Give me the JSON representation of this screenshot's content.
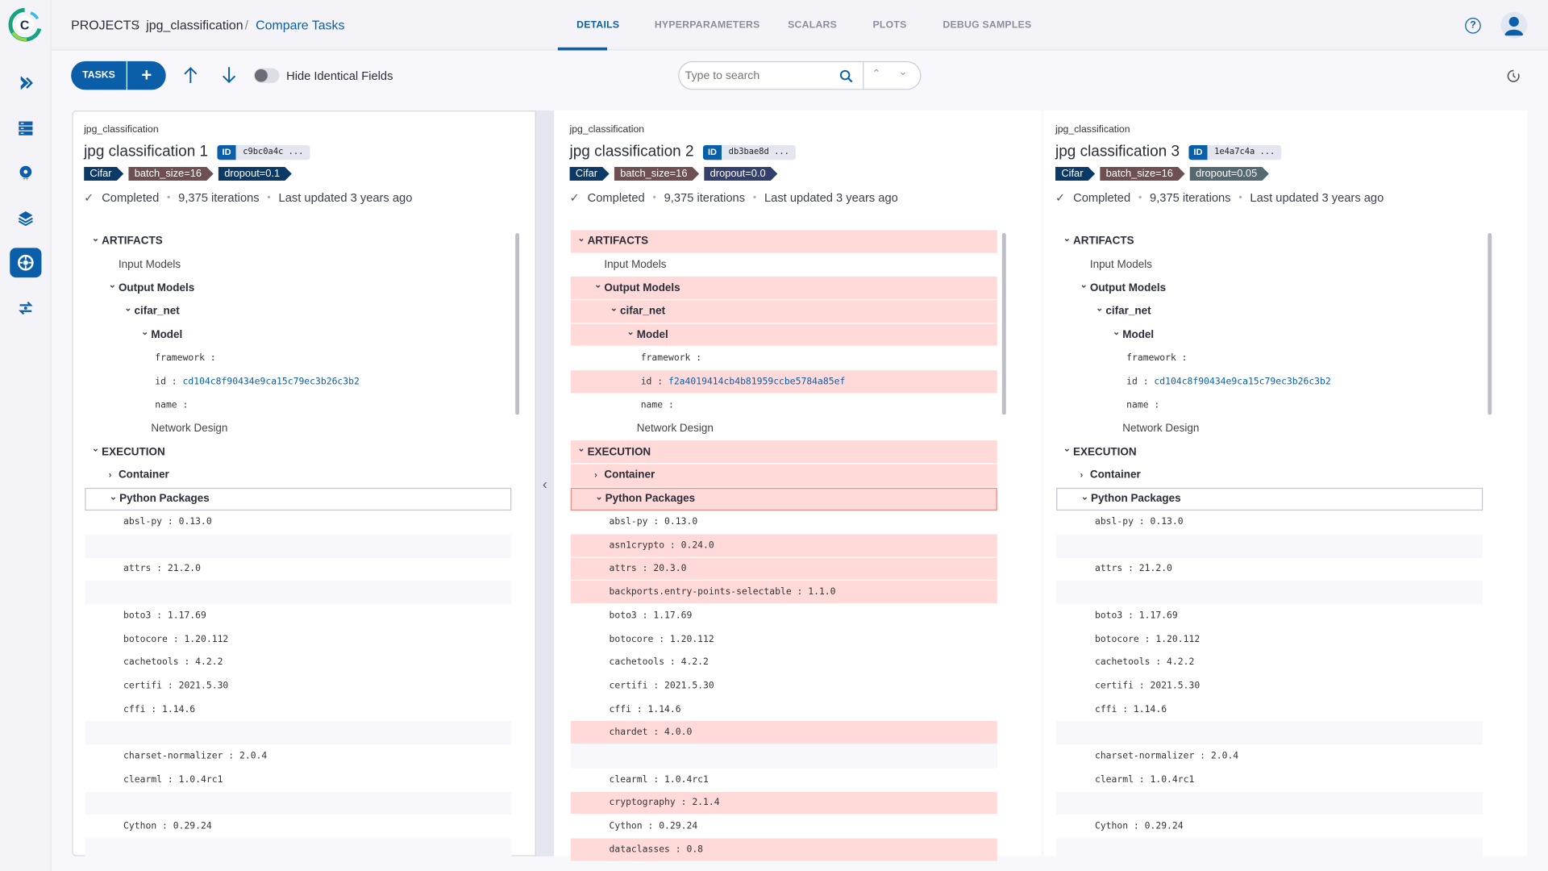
{
  "sidebar": {
    "items": [
      {
        "icon": "pipeline-arrow-icon",
        "active": false
      },
      {
        "icon": "datasets-grid-icon",
        "active": false
      },
      {
        "icon": "cloud-gear-icon",
        "active": false
      },
      {
        "icon": "layers-icon",
        "active": false
      },
      {
        "icon": "brain-models-icon",
        "active": true
      },
      {
        "icon": "orchestration-icon",
        "active": false
      }
    ]
  },
  "breadcrumb": {
    "root": "PROJECTS",
    "project": "jpg_classification",
    "current": "Compare Tasks",
    "sep": "/"
  },
  "tabs": [
    {
      "label": "DETAILS",
      "active": true
    },
    {
      "label": "HYPERPARAMETERS"
    },
    {
      "label": "SCALARS"
    },
    {
      "label": "PLOTS"
    },
    {
      "label": "DEBUG SAMPLES"
    }
  ],
  "toolbar": {
    "tasks_label": "TASKS",
    "add_label": "+",
    "hide_identical_label": "Hide Identical Fields",
    "hide_identical_on": false,
    "search_placeholder": "Type to search"
  },
  "colors": {
    "accent": "#0b5ea8",
    "diff": "#ffdad8",
    "tag_cifar": "#0b3a66",
    "tag_batch": "#6e5052"
  },
  "panels": [
    {
      "project": "jpg_classification",
      "title": "jpg classification 1",
      "id_label": "ID",
      "id": "c9bc0a4c ...",
      "tags": [
        {
          "text": "Cifar",
          "color": "#0b3a66"
        },
        {
          "text": "batch_size=16",
          "color": "#6e5052"
        },
        {
          "text": "dropout=0.1",
          "color": "#0b3a66"
        }
      ],
      "status": "Completed",
      "iterations": "9,375 iterations",
      "updated": "Last updated 3 years ago",
      "rows": [
        {
          "t": "ARTIFACTS",
          "k": "sec",
          "lvl": 0,
          "caret": "v"
        },
        {
          "t": "Input Models",
          "k": "grp0",
          "lvl": 1
        },
        {
          "t": "Output Models",
          "k": "grp",
          "lvl": 1,
          "caret": "v"
        },
        {
          "t": "cifar_net",
          "k": "grp",
          "lvl": 2,
          "caret": "v"
        },
        {
          "t": "Model",
          "k": "grp",
          "lvl": 3,
          "caret": "v"
        },
        {
          "t": "framework :",
          "k": "mono",
          "lvl": 4
        },
        {
          "t": "id :",
          "v": "cd104c8f90434e9ca15c79ec3b26c3b2",
          "k": "mono",
          "lvl": 4
        },
        {
          "t": "name :",
          "k": "mono",
          "lvl": 4
        },
        {
          "t": "Network Design",
          "k": "grp0",
          "lvl": 3
        },
        {
          "t": "EXECUTION",
          "k": "sec",
          "lvl": 0,
          "caret": "v"
        },
        {
          "t": "Container",
          "k": "grp",
          "lvl": 1,
          "caret": ">"
        },
        {
          "t": "Python Packages",
          "k": "grp",
          "lvl": 1,
          "caret": "v",
          "boxed": true
        },
        {
          "t": "absl-py : 0.13.0",
          "k": "pkg"
        },
        {
          "t": "",
          "k": "pkg",
          "blank": true
        },
        {
          "t": "attrs : 21.2.0",
          "k": "pkg"
        },
        {
          "t": "",
          "k": "pkg",
          "blank": true
        },
        {
          "t": "boto3 : 1.17.69",
          "k": "pkg"
        },
        {
          "t": "botocore : 1.20.112",
          "k": "pkg"
        },
        {
          "t": "cachetools : 4.2.2",
          "k": "pkg"
        },
        {
          "t": "certifi : 2021.5.30",
          "k": "pkg"
        },
        {
          "t": "cffi : 1.14.6",
          "k": "pkg"
        },
        {
          "t": "",
          "k": "pkg",
          "blank": true
        },
        {
          "t": "charset-normalizer : 2.0.4",
          "k": "pkg"
        },
        {
          "t": "clearml : 1.0.4rc1",
          "k": "pkg"
        },
        {
          "t": "",
          "k": "pkg",
          "blank": true
        },
        {
          "t": "Cython : 0.29.24",
          "k": "pkg"
        },
        {
          "t": "",
          "k": "pkg",
          "blank": true
        }
      ]
    },
    {
      "project": "jpg_classification",
      "title": "jpg classification 2",
      "id_label": "ID",
      "id": "db3bae8d ...",
      "tags": [
        {
          "text": "Cifar",
          "color": "#0b3a66"
        },
        {
          "text": "batch_size=16",
          "color": "#6e5052"
        },
        {
          "text": "dropout=0.0",
          "color": "#353f6b"
        }
      ],
      "status": "Completed",
      "iterations": "9,375 iterations",
      "updated": "Last updated 3 years ago",
      "rows": [
        {
          "t": "ARTIFACTS",
          "k": "sec",
          "lvl": 0,
          "caret": "v",
          "diff": true
        },
        {
          "t": "Input Models",
          "k": "grp0",
          "lvl": 1
        },
        {
          "t": "Output Models",
          "k": "grp",
          "lvl": 1,
          "caret": "v",
          "diff": true
        },
        {
          "t": "cifar_net",
          "k": "grp",
          "lvl": 2,
          "caret": "v",
          "diff": true
        },
        {
          "t": "Model",
          "k": "grp",
          "lvl": 3,
          "caret": "v",
          "diff": true
        },
        {
          "t": "framework :",
          "k": "mono",
          "lvl": 4
        },
        {
          "t": "id :",
          "v": "f2a4019414cb4b81959ccbe5784a85ef",
          "k": "mono",
          "lvl": 4,
          "diff": true
        },
        {
          "t": "name :",
          "k": "mono",
          "lvl": 4
        },
        {
          "t": "Network Design",
          "k": "grp0",
          "lvl": 3
        },
        {
          "t": "EXECUTION",
          "k": "sec",
          "lvl": 0,
          "caret": "v",
          "diff": true
        },
        {
          "t": "Container",
          "k": "grp",
          "lvl": 1,
          "caret": ">",
          "diff": true
        },
        {
          "t": "Python Packages",
          "k": "grp",
          "lvl": 1,
          "caret": "v",
          "boxed": true,
          "diff": true
        },
        {
          "t": "absl-py : 0.13.0",
          "k": "pkg"
        },
        {
          "t": "asn1crypto : 0.24.0",
          "k": "pkg",
          "diff": true
        },
        {
          "t": "attrs : 20.3.0",
          "k": "pkg",
          "diff": true
        },
        {
          "t": "backports.entry-points-selectable : 1.1.0",
          "k": "pkg",
          "diff": true
        },
        {
          "t": "boto3 : 1.17.69",
          "k": "pkg"
        },
        {
          "t": "botocore : 1.20.112",
          "k": "pkg"
        },
        {
          "t": "cachetools : 4.2.2",
          "k": "pkg"
        },
        {
          "t": "certifi : 2021.5.30",
          "k": "pkg"
        },
        {
          "t": "cffi : 1.14.6",
          "k": "pkg"
        },
        {
          "t": "chardet : 4.0.0",
          "k": "pkg",
          "diff": true
        },
        {
          "t": "",
          "k": "pkg",
          "blank": true
        },
        {
          "t": "clearml : 1.0.4rc1",
          "k": "pkg"
        },
        {
          "t": "cryptography : 2.1.4",
          "k": "pkg",
          "diff": true
        },
        {
          "t": "Cython : 0.29.24",
          "k": "pkg"
        },
        {
          "t": "dataclasses : 0.8",
          "k": "pkg",
          "diff": true
        }
      ]
    },
    {
      "project": "jpg_classification",
      "title": "jpg classification 3",
      "id_label": "ID",
      "id": "1e4a7c4a ...",
      "tags": [
        {
          "text": "Cifar",
          "color": "#0b3a66"
        },
        {
          "text": "batch_size=16",
          "color": "#6e5052"
        },
        {
          "text": "dropout=0.05",
          "color": "#546a70"
        }
      ],
      "status": "Completed",
      "iterations": "9,375 iterations",
      "updated": "Last updated 3 years ago",
      "rows": [
        {
          "t": "ARTIFACTS",
          "k": "sec",
          "lvl": 0,
          "caret": "v"
        },
        {
          "t": "Input Models",
          "k": "grp0",
          "lvl": 1
        },
        {
          "t": "Output Models",
          "k": "grp",
          "lvl": 1,
          "caret": "v"
        },
        {
          "t": "cifar_net",
          "k": "grp",
          "lvl": 2,
          "caret": "v"
        },
        {
          "t": "Model",
          "k": "grp",
          "lvl": 3,
          "caret": "v"
        },
        {
          "t": "framework :",
          "k": "mono",
          "lvl": 4
        },
        {
          "t": "id :",
          "v": "cd104c8f90434e9ca15c79ec3b26c3b2",
          "k": "mono",
          "lvl": 4
        },
        {
          "t": "name :",
          "k": "mono",
          "lvl": 4
        },
        {
          "t": "Network Design",
          "k": "grp0",
          "lvl": 3
        },
        {
          "t": "EXECUTION",
          "k": "sec",
          "lvl": 0,
          "caret": "v"
        },
        {
          "t": "Container",
          "k": "grp",
          "lvl": 1,
          "caret": ">"
        },
        {
          "t": "Python Packages",
          "k": "grp",
          "lvl": 1,
          "caret": "v",
          "boxed": true
        },
        {
          "t": "absl-py : 0.13.0",
          "k": "pkg"
        },
        {
          "t": "",
          "k": "pkg",
          "blank": true
        },
        {
          "t": "attrs : 21.2.0",
          "k": "pkg"
        },
        {
          "t": "",
          "k": "pkg",
          "blank": true
        },
        {
          "t": "boto3 : 1.17.69",
          "k": "pkg"
        },
        {
          "t": "botocore : 1.20.112",
          "k": "pkg"
        },
        {
          "t": "cachetools : 4.2.2",
          "k": "pkg"
        },
        {
          "t": "certifi : 2021.5.30",
          "k": "pkg"
        },
        {
          "t": "cffi : 1.14.6",
          "k": "pkg"
        },
        {
          "t": "",
          "k": "pkg",
          "blank": true
        },
        {
          "t": "charset-normalizer : 2.0.4",
          "k": "pkg"
        },
        {
          "t": "clearml : 1.0.4rc1",
          "k": "pkg"
        },
        {
          "t": "",
          "k": "pkg",
          "blank": true
        },
        {
          "t": "Cython : 0.29.24",
          "k": "pkg"
        },
        {
          "t": "",
          "k": "pkg",
          "blank": true
        }
      ]
    }
  ]
}
